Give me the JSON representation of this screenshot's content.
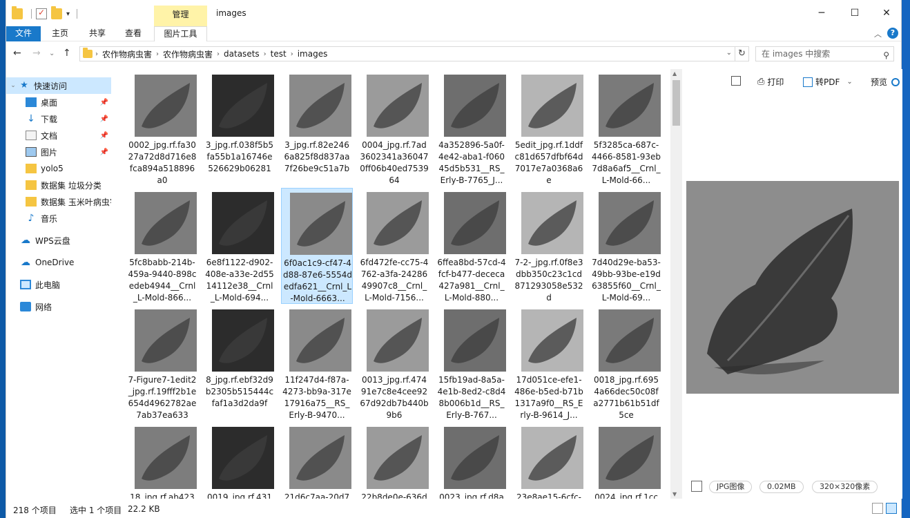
{
  "window": {
    "title": "images",
    "context_tab": "管理",
    "controls": {
      "minimize": "─",
      "maximize": "☐",
      "close": "✕"
    }
  },
  "ribbon": {
    "tabs": [
      "文件",
      "主页",
      "共享",
      "查看",
      "图片工具"
    ],
    "active_tab": "图片工具",
    "help": "?"
  },
  "address": {
    "crumbs": [
      "农作物病虫害",
      "农作物病虫害",
      "datasets",
      "test",
      "images"
    ]
  },
  "search": {
    "placeholder": "在 images 中搜索"
  },
  "nav": {
    "quick_access": "快速访问",
    "items": [
      "桌面",
      "下载",
      "文档",
      "图片",
      "yolo5",
      "数据集 垃圾分类",
      "数据集 玉米叶病虫害",
      "音乐"
    ],
    "wps": "WPS云盘",
    "onedrive": "OneDrive",
    "pc": "此电脑",
    "network": "网络"
  },
  "files": [
    {
      "name": "0002_jpg.rf.fa3027a72d8d716e8fca894a518896a0"
    },
    {
      "name": "3_jpg.rf.038f5b5fa55b1a16746e526629b06281"
    },
    {
      "name": "3_jpg.rf.82e2466a825f8d837aa7f26be9c51a7b"
    },
    {
      "name": "0004_jpg.rf.7ad3602341a360470ff06b40ed753964"
    },
    {
      "name": "4a352896-5a0f-4e42-aba1-f06045d5b531__RS_Erly-B-7765_J..."
    },
    {
      "name": "5edit_jpg.rf.1ddfc81d657dfbf64d7017e7a0368a6e"
    },
    {
      "name": "5f3285ca-687c-4466-8581-93eb7d8a6af5__Crnl_L-Mold-66..."
    },
    {
      "name": "5fc8babb-214b-459a-9440-898cedeb4944__Crnl_L-Mold-866..."
    },
    {
      "name": "6e8f1122-d902-408e-a33e-2d5514112e38__Crnl_L-Mold-694..."
    },
    {
      "name": "6f0ac1c9-cf47-4d88-87e6-5554dedfa621__Crnl_L-Mold-6663..."
    },
    {
      "name": "6fd472fe-cc75-4762-a3fa-2428649907c8__Crnl_L-Mold-7156..."
    },
    {
      "name": "6ffea8bd-57cd-4fcf-b477-dececa427a981__Crnl_L-Mold-880..."
    },
    {
      "name": "7-2-_jpg.rf.0f8e3dbb350c23c1cd871293058e532d"
    },
    {
      "name": "7d40d29e-ba53-49bb-93be-e19d63855f60__Crnl_L-Mold-69..."
    },
    {
      "name": "7-Figure7-1edit2_jpg.rf.19fff2b1e654d4962782ae7ab37ea633"
    },
    {
      "name": "8_jpg.rf.ebf32d9b2305b515444cfaf1a3d2da9f"
    },
    {
      "name": "11f247d4-f87a-4273-bb9a-317e17916a75__RS_Erly-B-9470..."
    },
    {
      "name": "0013_jpg.rf.47491e7c8e4cee9267d92db7b440b9b6"
    },
    {
      "name": "15fb19ad-8a5a-4e1b-8ed2-c8d48b006b1d__RS_Erly-B-767..."
    },
    {
      "name": "17d051ce-efe1-486e-b5ed-b71b1317a9f0__RS_Erly-B-9614_J..."
    },
    {
      "name": "0018_jpg.rf.6954a66dec50c08fa2771b61b51df5ce"
    },
    {
      "name": "18_jpg.rf.ab423"
    },
    {
      "name": "0019_jpg.rf.431"
    },
    {
      "name": "21d6c7aa-20d7"
    },
    {
      "name": "22b8de0e-636d"
    },
    {
      "name": "0023_jpg.rf.d8a"
    },
    {
      "name": "23e8ae15-6cfc-"
    },
    {
      "name": "0024_jpg.rf.1cc"
    }
  ],
  "preview": {
    "print": "打印",
    "to_pdf": "转PDF",
    "preview_label": "预览",
    "type": "JPG图像",
    "size": "0.02MB",
    "dimensions": "320×320像素"
  },
  "status": {
    "count": "218 个项目",
    "selection": "选中 1 个项目",
    "sel_size": "22.2 KB"
  }
}
